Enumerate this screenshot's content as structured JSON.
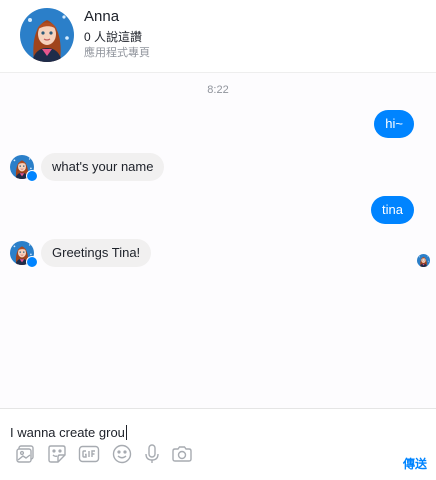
{
  "header": {
    "name": "Anna",
    "readers": "0 人說這讚",
    "category": "應用程式專頁"
  },
  "thread": {
    "timestamp": "8:22",
    "messages": [
      {
        "direction": "out",
        "text": "hi~"
      },
      {
        "direction": "in",
        "text": "what's your name"
      },
      {
        "direction": "out",
        "text": "tina"
      },
      {
        "direction": "in",
        "text": "Greetings Tina!"
      }
    ]
  },
  "composer": {
    "draft": "I wanna create grou",
    "send_label": "傳送",
    "tools": [
      "image-icon",
      "sticker-icon",
      "gif-icon",
      "emoji-icon",
      "microphone-icon",
      "camera-icon"
    ]
  },
  "colors": {
    "accent": "#0084ff",
    "incoming_bubble": "#f1f0f0",
    "muted_text": "#90949c"
  }
}
